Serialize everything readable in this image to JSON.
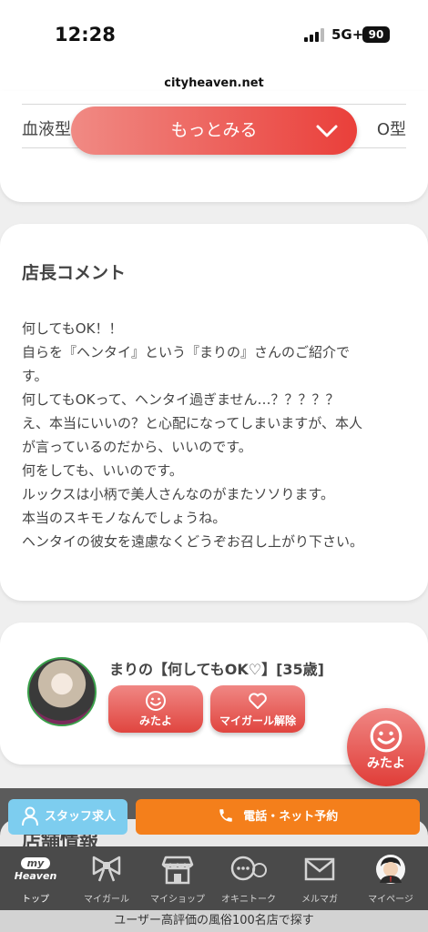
{
  "status": {
    "time": "12:28",
    "network": "5G+",
    "battery": "90"
  },
  "browser": {
    "url": "cityheaven.net"
  },
  "profile": {
    "label": "血液型",
    "value": "O型",
    "more_button": "もっとみる"
  },
  "comment": {
    "title": "店長コメント",
    "lines": [
      "何してもOK！！",
      "自らを『ヘンタイ』という『まりの』さんのご紹介で",
      "す。",
      "何してもOKって、ヘンタイ過ぎません…？？？？？",
      "え、本当にいいの？と心配になってしまいますが、本人",
      "が言っているのだから、いいのです。",
      "何をしても、いいのです。",
      "ルックスは小柄で美人さんなのがまたソソります。",
      "本当のスキモノなんでしょうね。",
      "ヘンタイの彼女を遠慮なくどうぞお召し上がり下さい。"
    ]
  },
  "girl": {
    "name": "まりの【何してもOK♡】[35歳]",
    "mitayo_label": "みたよ",
    "mygirl_label": "マイガール解除"
  },
  "fab": {
    "label": "みたよ"
  },
  "sections": {
    "next_title": "店舗情報"
  },
  "cta": {
    "staff_label": "スタッフ求人",
    "reserve_label": "電話・ネット予約"
  },
  "tabbar": {
    "logo_top": "my",
    "logo_bottom": "Heaven",
    "items": [
      "トップ",
      "マイガール",
      "マイショップ",
      "オキニトーク",
      "メルマガ",
      "マイページ"
    ]
  },
  "banner": {
    "text": "ユーザー高評価の風俗100名店で探す"
  },
  "colors": {
    "accent_red": "#ea3f3a",
    "orange": "#f47f1b",
    "light_blue": "#7dcdef"
  }
}
